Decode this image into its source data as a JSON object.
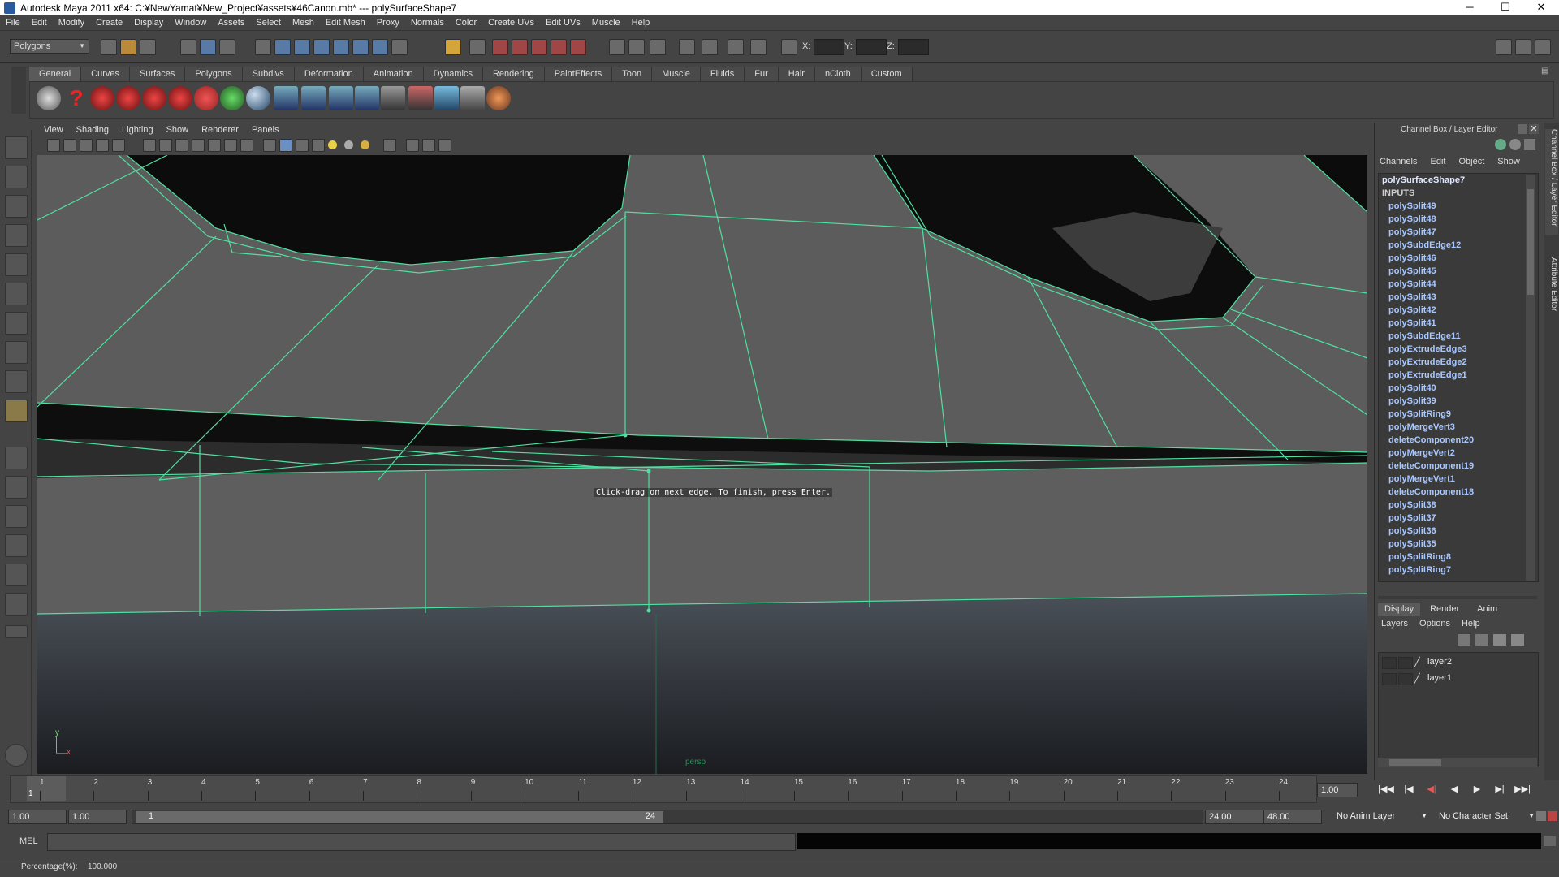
{
  "window": {
    "title": "Autodesk Maya 2011 x64: C:¥NewYamat¥New_Project¥assets¥46Canon.mb*   ---   polySurfaceShape7",
    "minimize": "─",
    "maximize": "☐",
    "close": "✕"
  },
  "menubar": [
    "File",
    "Edit",
    "Modify",
    "Create",
    "Display",
    "Window",
    "Assets",
    "Select",
    "Mesh",
    "Edit Mesh",
    "Proxy",
    "Normals",
    "Color",
    "Create UVs",
    "Edit UVs",
    "Muscle",
    "Help"
  ],
  "statusline": {
    "mode_dropdown": "Polygons",
    "x_label": "X:",
    "y_label": "Y:",
    "z_label": "Z:"
  },
  "shelf": {
    "tabs": [
      "General",
      "Curves",
      "Surfaces",
      "Polygons",
      "Subdivs",
      "Deformation",
      "Animation",
      "Dynamics",
      "Rendering",
      "PaintEffects",
      "Toon",
      "Muscle",
      "Fluids",
      "Fur",
      "Hair",
      "nCloth",
      "Custom"
    ],
    "active_tab": "General"
  },
  "viewport": {
    "menu": [
      "View",
      "Shading",
      "Lighting",
      "Show",
      "Renderer",
      "Panels"
    ],
    "hint": "Click-drag on next edge. To finish, press Enter.",
    "camera_label": "persp",
    "axis_y": "y",
    "axis_x": "x",
    "wire_color": "#4fe0a0"
  },
  "channel_box": {
    "header": "Channel Box / Layer Editor",
    "menu": [
      "Channels",
      "Edit",
      "Object",
      "Show"
    ],
    "object_name": "polySurfaceShape7",
    "inputs_label": "INPUTS",
    "inputs": [
      "polySplit49",
      "polySplit48",
      "polySplit47",
      "polySubdEdge12",
      "polySplit46",
      "polySplit45",
      "polySplit44",
      "polySplit43",
      "polySplit42",
      "polySplit41",
      "polySubdEdge11",
      "polyExtrudeEdge3",
      "polyExtrudeEdge2",
      "polyExtrudeEdge1",
      "polySplit40",
      "polySplit39",
      "polySplitRing9",
      "polyMergeVert3",
      "deleteComponent20",
      "polyMergeVert2",
      "deleteComponent19",
      "polyMergeVert1",
      "deleteComponent18",
      "polySplit38",
      "polySplit37",
      "polySplit36",
      "polySplit35",
      "polySplitRing8",
      "polySplitRing7"
    ]
  },
  "side_tabs": [
    "Channel Box / Layer Editor",
    "Attribute Editor"
  ],
  "layer_editor": {
    "tabs": [
      "Display",
      "Render",
      "Anim"
    ],
    "active_tab": "Display",
    "menu": [
      "Layers",
      "Options",
      "Help"
    ],
    "layers": [
      "layer2",
      "layer1"
    ]
  },
  "timeline": {
    "ticks": [
      "1",
      "2",
      "3",
      "4",
      "5",
      "6",
      "7",
      "8",
      "9",
      "10",
      "11",
      "12",
      "13",
      "14",
      "15",
      "16",
      "17",
      "18",
      "19",
      "20",
      "21",
      "22",
      "23",
      "24"
    ],
    "current_frame": "1",
    "current_time_field": "1.00",
    "playback": [
      "|◀◀",
      "|◀",
      "◀|",
      "◀",
      "▶",
      "▶|",
      "▶▶|"
    ]
  },
  "range": {
    "start_time": "1.00",
    "playback_start": "1.00",
    "slider_start": "1",
    "slider_end": "24",
    "playback_end": "24.00",
    "end_time": "48.00",
    "anim_layer": "No Anim Layer",
    "character_set": "No Character Set"
  },
  "command_line": {
    "label": "MEL"
  },
  "help_line": {
    "text": "Percentage(%):",
    "value": "100.000"
  }
}
